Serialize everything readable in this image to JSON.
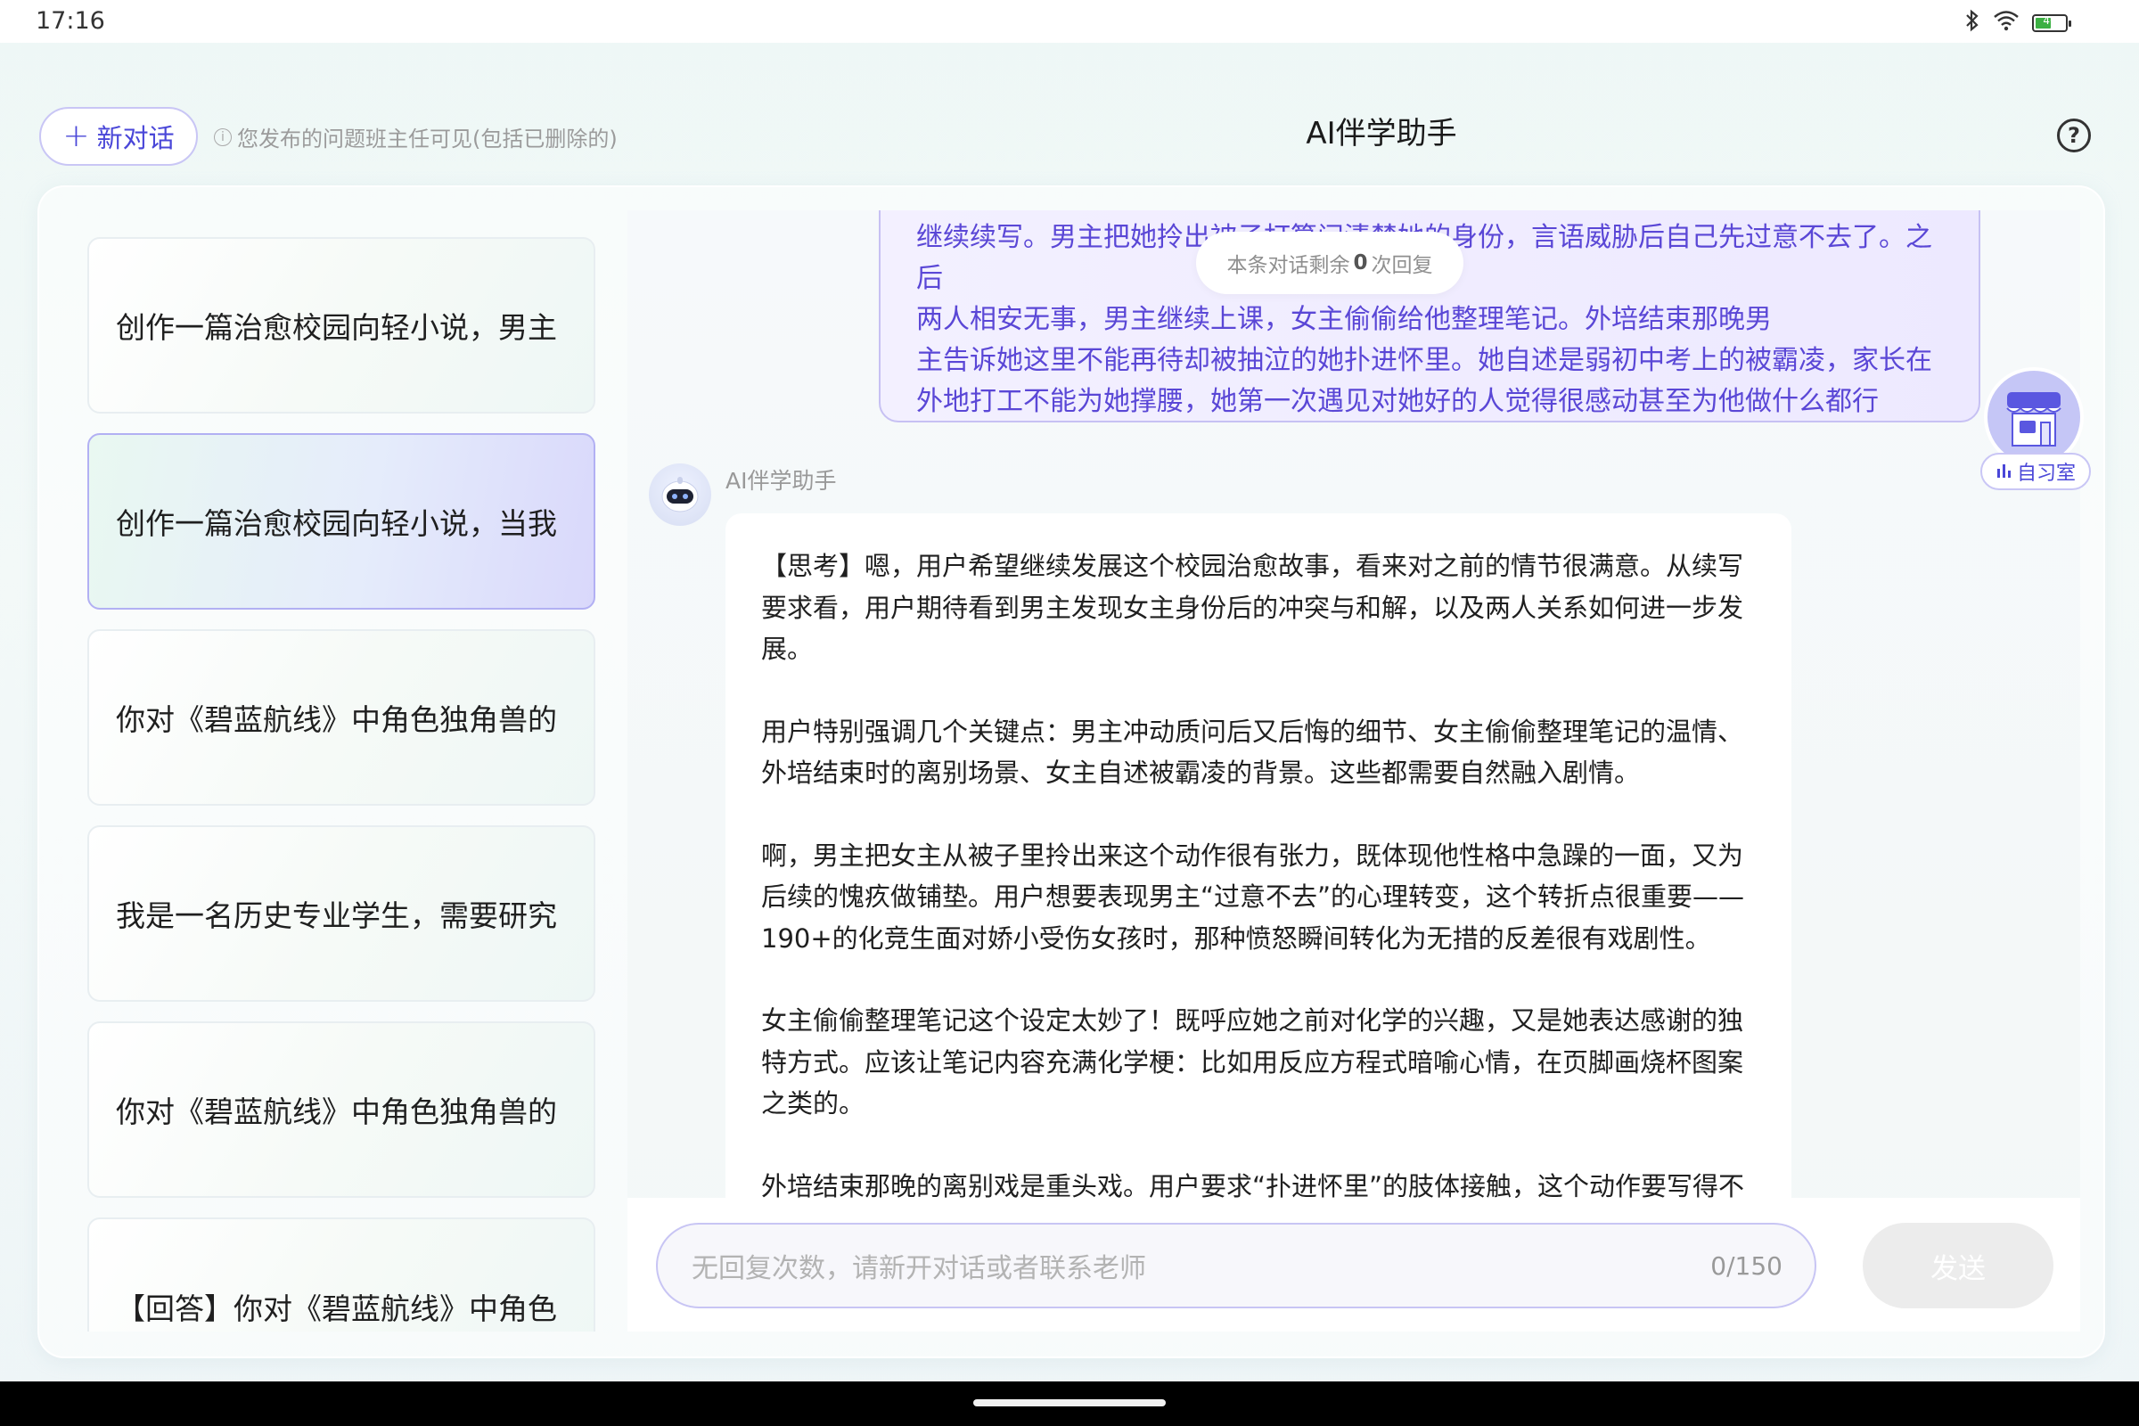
{
  "status_bar": {
    "time": "17:16",
    "battery_level": "46",
    "icons": [
      "bluetooth-icon",
      "wifi-icon",
      "battery-icon"
    ]
  },
  "header": {
    "new_chat_label": "新对话",
    "notice": "您发布的问题班主任可见(包括已删除的)",
    "title": "AI伴学助手"
  },
  "sidebar": {
    "items": [
      {
        "label": "创作一篇治愈校园向轻小说，男主",
        "active": false
      },
      {
        "label": "创作一篇治愈校园向轻小说，当我",
        "active": true
      },
      {
        "label": "你对《碧蓝航线》中角色独角兽的",
        "active": false
      },
      {
        "label": "我是一名历史专业学生，需要研究",
        "active": false
      },
      {
        "label": "你对《碧蓝航线》中角色独角兽的",
        "active": false
      },
      {
        "label": "【回答】你对《碧蓝航线》中角色",
        "active": false
      }
    ]
  },
  "chat": {
    "user_message_lines": [
      "继续续写。男主把她拎出被子打算问清楚她的身份，言语威胁后自己先过意不去了。之后",
      "两人相安无事，男主继续上课，女主偷偷给他整理笔记。外培结束那晚男",
      "主告诉她这里不能再待却被抽泣的她扑进怀里。她自述是弱初中考上的被霸凌，家长在",
      "外地打工不能为她撑腰，她第一次遇见对她好的人觉得很感动甚至为他做什么都行"
    ],
    "remaining": {
      "prefix": "本条对话剩余",
      "count": "0",
      "suffix": "次回复"
    },
    "ai_name": "AI伴学助手",
    "ai_paragraphs": [
      "【思考】嗯，用户希望继续发展这个校园治愈故事，看来对之前的情节很满意。从续写要求看，用户期待看到男主发现女主身份后的冲突与和解，以及两人关系如何进一步发展。",
      "用户特别强调几个关键点：男主冲动质问后又后悔的细节、女主偷偷整理笔记的温情、外培结束时的离别场景、女主自述被霸凌的背景。这些都需要自然融入剧情。",
      "啊，男主把女主从被子里拎出来这个动作很有张力，既体现他性格中急躁的一面，又为后续的愧疚做铺垫。用户想要表现男主“过意不去”的心理转变，这个转折点很重要——190+的化竞生面对娇小受伤女孩时，那种愤怒瞬间转化为无措的反差很有戏剧性。",
      "女主偷偷整理笔记这个设定太妙了！既呼应她之前对化学的兴趣，又是她表达感谢的独特方式。应该让笔记内容充满化学梗：比如用反应方程式暗喻心情，在页脚画烧杯图案之类的。",
      "外培结束那晚的离别戏是重头戏。用户要求“扑进怀里”的肢体接触，这个动作要写得不突"
    ]
  },
  "study_room": {
    "label": "自习室",
    "badge": "自习"
  },
  "input": {
    "placeholder": "无回复次数，请新开对话或者联系老师",
    "count": "0/150",
    "send_label": "发送"
  },
  "colors": {
    "accent": "#4a47d8",
    "user_text": "#5a47d6",
    "active_border": "#b2b0f3"
  }
}
